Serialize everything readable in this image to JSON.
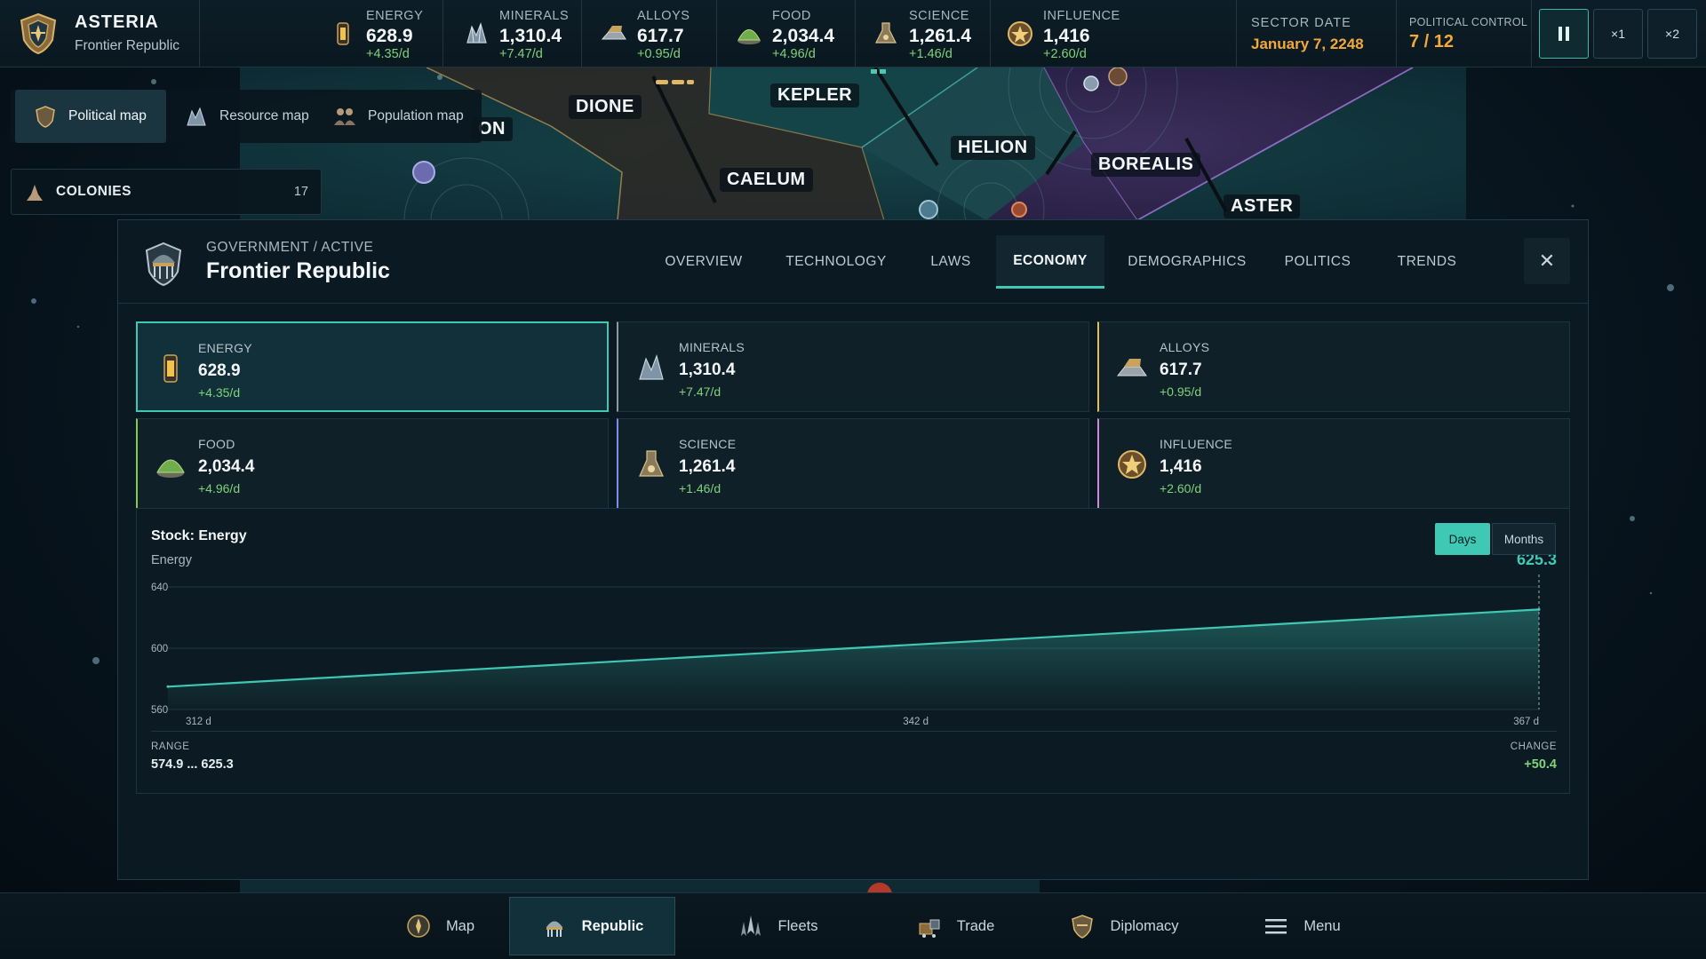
{
  "brand": {
    "name": "ASTERIA",
    "subtitle": "Frontier Republic"
  },
  "resources": [
    {
      "label": "ENERGY",
      "value": "628.9",
      "rate": "+4.35/d",
      "icon": "energy-cell-icon"
    },
    {
      "label": "MINERALS",
      "value": "1,310.4",
      "rate": "+7.47/d",
      "icon": "mineral-crystal-icon"
    },
    {
      "label": "ALLOYS",
      "value": "617.7",
      "rate": "+0.95/d",
      "icon": "alloy-ingot-icon"
    },
    {
      "label": "FOOD",
      "value": "2,034.4",
      "rate": "+4.96/d",
      "icon": "food-dome-icon"
    },
    {
      "label": "SCIENCE",
      "value": "1,261.4",
      "rate": "+1.46/d",
      "icon": "science-flask-icon"
    },
    {
      "label": "INFLUENCE",
      "value": "1,416",
      "rate": "+2.60/d",
      "icon": "influence-medal-icon"
    }
  ],
  "sector_date": {
    "label": "SECTOR DATE",
    "value": "January 7, 2248"
  },
  "political_control": {
    "label": "POLITICAL CONTROL",
    "value": "7 / 12"
  },
  "speed": {
    "x1": "×1",
    "x2": "×2"
  },
  "map": {
    "regions": [
      "ON",
      "DIONE",
      "KEPLER",
      "CAELUM",
      "HELION",
      "BOREALIS",
      "ASTER"
    ]
  },
  "map_modes": [
    {
      "label": "Political map",
      "icon": "political-map-icon"
    },
    {
      "label": "Resource map",
      "icon": "resource-map-icon"
    },
    {
      "label": "Population map",
      "icon": "population-map-icon"
    }
  ],
  "colonies": {
    "label": "COLONIES",
    "count": "17"
  },
  "panel": {
    "kicker": "GOVERNMENT / ACTIVE",
    "title": "Frontier Republic",
    "tabs": [
      "OVERVIEW",
      "TECHNOLOGY",
      "LAWS",
      "ECONOMY",
      "DEMOGRAPHICS",
      "POLITICS",
      "TRENDS"
    ],
    "active_tab": "ECONOMY",
    "close": "✕"
  },
  "cards": [
    {
      "label": "ENERGY",
      "value": "628.9",
      "rate": "+4.35/d",
      "accent": "#3fc9b5"
    },
    {
      "label": "MINERALS",
      "value": "1,310.4",
      "rate": "+7.47/d",
      "accent": "#8d9aa3"
    },
    {
      "label": "ALLOYS",
      "value": "617.7",
      "rate": "+0.95/d",
      "accent": "#e3c04a"
    },
    {
      "label": "FOOD",
      "value": "2,034.4",
      "rate": "+4.96/d",
      "accent": "#86c957"
    },
    {
      "label": "SCIENCE",
      "value": "1,261.4",
      "rate": "+1.46/d",
      "accent": "#7f8cf0"
    },
    {
      "label": "INFLUENCE",
      "value": "1,416",
      "rate": "+2.60/d",
      "accent": "#c98ad9"
    }
  ],
  "chart": {
    "title": "Stock: Energy",
    "series_label": "Energy",
    "current_value": "625.3",
    "toggle_days": "Days",
    "toggle_months": "Months",
    "range_label": "RANGE",
    "range_value": "574.9 ... 625.3",
    "change_label": "CHANGE",
    "change_value": "+50.4"
  },
  "chart_data": {
    "type": "area",
    "title": "Stock: Energy",
    "ylabel": "Energy",
    "x": [
      312,
      367
    ],
    "x_tick_labels": [
      "312 d",
      "342 d",
      "367 d"
    ],
    "x_ticks": [
      312,
      342,
      367
    ],
    "series": [
      {
        "name": "Energy",
        "values": [
          574.9,
          625.3
        ]
      }
    ],
    "ylim": [
      560,
      640
    ],
    "y_ticks": [
      560,
      600,
      640
    ],
    "grid": true,
    "color": "#3fc9b5"
  },
  "bottom_nav": [
    {
      "label": "Map",
      "icon": "compass-map-icon"
    },
    {
      "label": "Republic",
      "icon": "republic-crest-icon"
    },
    {
      "label": "Fleets",
      "icon": "fleet-ships-icon"
    },
    {
      "label": "Trade",
      "icon": "trade-cargo-icon"
    },
    {
      "label": "Diplomacy",
      "icon": "diplomacy-shield-icon"
    },
    {
      "label": "Menu",
      "icon": "hamburger-menu-icon"
    }
  ],
  "bottom_nav_active": "Republic"
}
